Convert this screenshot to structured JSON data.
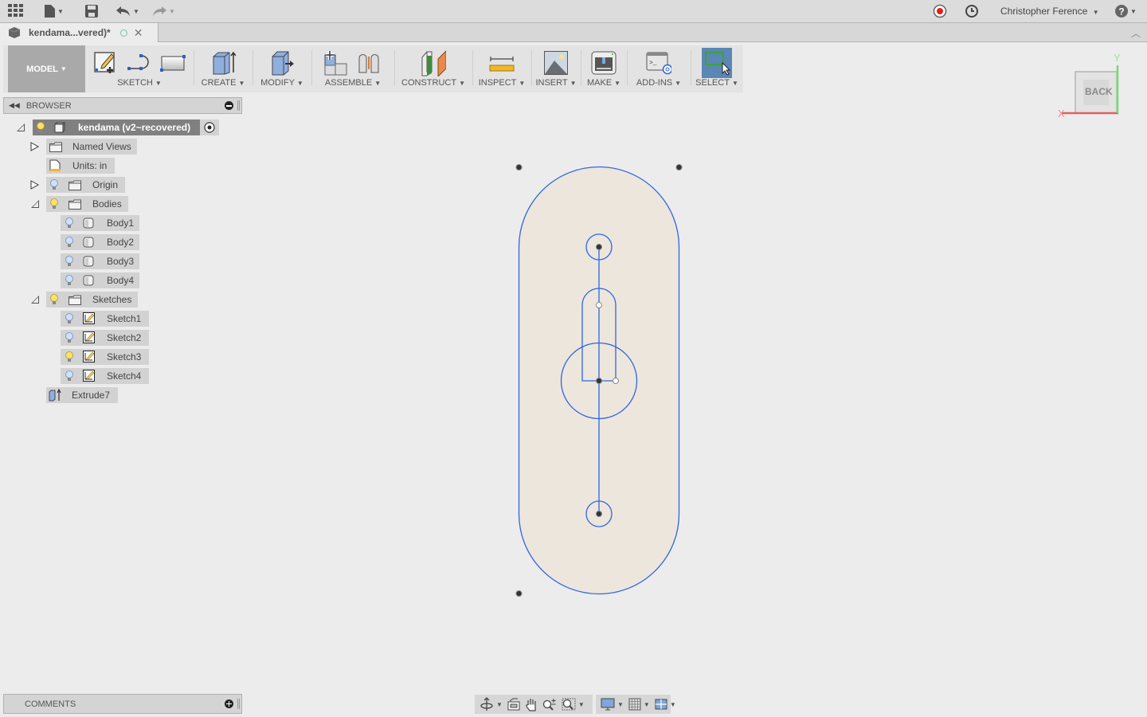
{
  "appbar": {
    "user_name": "Christopher Ference",
    "icons": [
      "app-grid-icon",
      "file-icon",
      "save-icon",
      "undo-icon",
      "redo-icon",
      "record-icon",
      "history-clock-icon",
      "help-icon"
    ]
  },
  "document_tab": {
    "title": "kendama...vered)*",
    "status": "saved-indicator"
  },
  "toolbar": {
    "workspace": "MODEL",
    "groups": [
      {
        "label": "SKETCH",
        "icons": [
          "create-sketch-icon",
          "arc-line-icon",
          "rectangle-icon"
        ]
      },
      {
        "label": "CREATE",
        "icons": [
          "extrude-icon"
        ]
      },
      {
        "label": "MODIFY",
        "icons": [
          "press-pull-icon"
        ]
      },
      {
        "label": "ASSEMBLE",
        "icons": [
          "new-component-icon",
          "joint-icon"
        ]
      },
      {
        "label": "CONSTRUCT",
        "icons": [
          "offset-plane-icon"
        ]
      },
      {
        "label": "INSPECT",
        "icons": [
          "measure-icon"
        ]
      },
      {
        "label": "INSERT",
        "icons": [
          "insert-image-icon"
        ]
      },
      {
        "label": "MAKE",
        "icons": [
          "3d-print-icon"
        ]
      },
      {
        "label": "ADD-INS",
        "icons": [
          "scripts-addins-icon"
        ]
      },
      {
        "label": "SELECT",
        "icons": [
          "select-window-icon"
        ]
      }
    ]
  },
  "browser": {
    "title": "BROWSER",
    "root": "kendama (v2~recovered)",
    "items": {
      "named_views": "Named Views",
      "units": "Units: in",
      "origin": "Origin",
      "bodies": "Bodies",
      "body1": "Body1",
      "body2": "Body2",
      "body3": "Body3",
      "body4": "Body4",
      "sketches": "Sketches",
      "sketch1": "Sketch1",
      "sketch2": "Sketch2",
      "sketch3": "Sketch3",
      "sketch4": "Sketch4",
      "extrude7": "Extrude7"
    },
    "visibility": {
      "root": true,
      "origin": false,
      "bodies": true,
      "body1": false,
      "body2": false,
      "body3": false,
      "body4": false,
      "sketches": true,
      "sketch1": false,
      "sketch2": false,
      "sketch3": true,
      "sketch4": false
    }
  },
  "comments": {
    "title": "COMMENTS"
  },
  "viewcube": {
    "face": "BACK",
    "x_axis": "X",
    "y_axis": "Y"
  },
  "colors": {
    "sketch_line": "#2f66e0",
    "profile_fill": "#ede6dd",
    "select_active": "#5a87b4",
    "x_axis": "#e06060",
    "y_axis": "#70dd70"
  }
}
